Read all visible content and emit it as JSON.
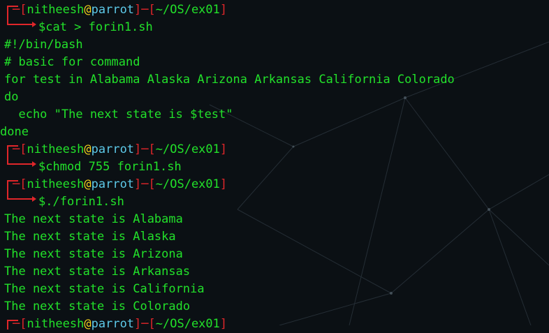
{
  "prompt": {
    "user": "nitheesh",
    "at": "@",
    "host": "parrot",
    "path": "~/OS/ex01"
  },
  "lines": {
    "cmd1": "$cat > forin1.sh",
    "l1": "#!/bin/bash",
    "l2": "# basic for command",
    "l3": "for test in Alabama Alaska Arizona Arkansas California Colorado",
    "l4": "do",
    "l5": "  echo \"The next state is $test\"",
    "l6": "done",
    "cmd2": "$chmod 755 forin1.sh",
    "cmd3": "$./forin1.sh",
    "o1": "The next state is Alabama",
    "o2": "The next state is Alaska",
    "o3": "The next state is Arizona",
    "o4": "The next state is Arkansas",
    "o5": "The next state is California",
    "o6": "The next state is Colorado"
  },
  "colors": {
    "text_green": "#22e12a",
    "bracket_red": "#e0262a",
    "at_yellow": "#f4d01c",
    "host_cyan": "#5dc9e8",
    "background": "#0b1014"
  }
}
